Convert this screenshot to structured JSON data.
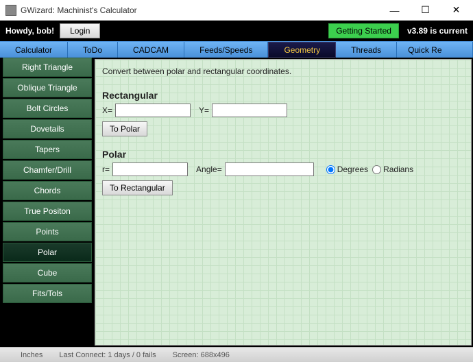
{
  "window": {
    "title": "GWizard: Machinist's Calculator"
  },
  "header": {
    "greeting": "Howdy, bob!",
    "login": "Login",
    "getting_started": "Getting Started",
    "version": "v3.89 is current"
  },
  "tabs": [
    "Calculator",
    "ToDo",
    "CADCAM",
    "Feeds/Speeds",
    "Geometry",
    "Threads",
    "Quick Re"
  ],
  "tabs_active_index": 4,
  "sidebar": {
    "items": [
      "Right Triangle",
      "Oblique Triangle",
      "Bolt Circles",
      "Dovetails",
      "Tapers",
      "Chamfer/Drill",
      "Chords",
      "True Positon",
      "Points",
      "Polar",
      "Cube",
      "Fits/Tols"
    ],
    "active_index": 9
  },
  "main": {
    "description": "Convert between polar and rectangular coordinates.",
    "rect_title": "Rectangular",
    "x_label": "X=",
    "x_value": "",
    "y_label": "Y=",
    "y_value": "",
    "to_polar_btn": "To Polar",
    "polar_title": "Polar",
    "r_label": "r=",
    "r_value": "",
    "angle_label": "Angle=",
    "angle_value": "",
    "degrees_label": "Degrees",
    "radians_label": "Radians",
    "to_rect_btn": "To Rectangular"
  },
  "statusbar": {
    "units": "Inches",
    "connect": "Last Connect: 1 days / 0 fails",
    "screen": "Screen: 688x496"
  }
}
